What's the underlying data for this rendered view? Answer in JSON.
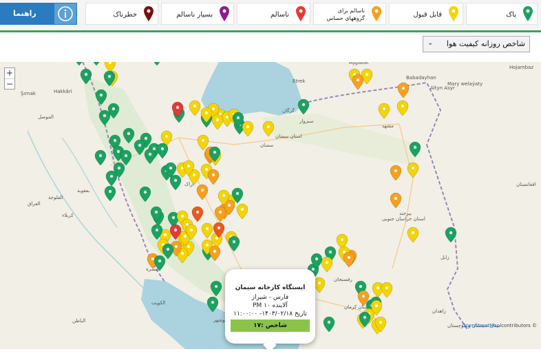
{
  "legend": {
    "items": [
      {
        "label": "پاک",
        "color": "#1aa260"
      },
      {
        "label": "قابل قبول",
        "color": "#f5d400"
      },
      {
        "label": "ناسالم برای گروههای حساس",
        "color": "#f7a01b"
      },
      {
        "label": "ناسالم",
        "color": "#e53935"
      },
      {
        "label": "بسیار ناسالم",
        "color": "#8e1a8e"
      },
      {
        "label": "خطرناک",
        "color": "#7b0f0f"
      }
    ],
    "help_label": "راهنما",
    "help_icon": "info-icon"
  },
  "toolbar": {
    "select_value": "شاخص روزانه کیفیت هوا"
  },
  "map": {
    "zoom_in": "+",
    "zoom_out": "−",
    "attribution_link": "OpenStreetMap",
    "attribution_text": " contributors ©",
    "labels": [
      {
        "text": "Aşgabat"
      },
      {
        "text": "Etrek"
      },
      {
        "text": "Babadayhan"
      },
      {
        "text": "Altyn Asyr"
      },
      {
        "text": "Hojambaz"
      },
      {
        "text": "Mary welaýaty"
      },
      {
        "text": "Şırnak"
      },
      {
        "text": "Hakkâri"
      },
      {
        "text": "الموصل"
      },
      {
        "text": "العراق"
      },
      {
        "text": "بعقوبة"
      },
      {
        "text": "الفلوجة"
      },
      {
        "text": "کربلاء"
      },
      {
        "text": "البصرة"
      },
      {
        "text": "الكويت"
      },
      {
        "text": "الباطن"
      },
      {
        "text": "گرگان"
      },
      {
        "text": "سمنان"
      },
      {
        "text": "سبزوار"
      },
      {
        "text": "مشهد"
      },
      {
        "text": "بیرجند"
      },
      {
        "text": "اراک"
      },
      {
        "text": "زابل"
      },
      {
        "text": "زاهدان"
      },
      {
        "text": "رفسنجان"
      },
      {
        "text": "استان کرمان"
      },
      {
        "text": "بم"
      },
      {
        "text": "استان بوشهر"
      },
      {
        "text": "افغانستان"
      },
      {
        "text": "استان خراسان جنوبی"
      },
      {
        "text": "استان سمنان"
      },
      {
        "text": "استان سیستان و بلوچستان"
      }
    ],
    "pins": [
      {
        "c": "#1aa260"
      },
      {
        "c": "#1aa260"
      },
      {
        "c": "#1aa260"
      },
      {
        "c": "#1aa260"
      },
      {
        "c": "#1aa260"
      },
      {
        "c": "#f5d400"
      },
      {
        "c": "#f5d400"
      },
      {
        "c": "#1aa260"
      },
      {
        "c": "#1aa260"
      },
      {
        "c": "#1aa260"
      },
      {
        "c": "#1aa260"
      },
      {
        "c": "#1aa260"
      },
      {
        "c": "#1aa260"
      },
      {
        "c": "#1aa260"
      },
      {
        "c": "#f5d400"
      },
      {
        "c": "#1aa260"
      },
      {
        "c": "#1aa260"
      },
      {
        "c": "#1aa260"
      },
      {
        "c": "#1aa260"
      },
      {
        "c": "#1aa260"
      },
      {
        "c": "#1aa260"
      },
      {
        "c": "#1aa260"
      },
      {
        "c": "#1aa260"
      },
      {
        "c": "#1aa260"
      },
      {
        "c": "#1aa260"
      },
      {
        "c": "#1aa260"
      },
      {
        "c": "#1aa260"
      },
      {
        "c": "#f5d400"
      },
      {
        "c": "#1aa260"
      },
      {
        "c": "#1aa260"
      },
      {
        "c": "#1aa260"
      },
      {
        "c": "#f5d400"
      },
      {
        "c": "#f5d400"
      },
      {
        "c": "#f5d400"
      },
      {
        "c": "#f7a01b"
      },
      {
        "c": "#f7a01b"
      },
      {
        "c": "#f5d400"
      },
      {
        "c": "#1aa260"
      },
      {
        "c": "#1aa260"
      },
      {
        "c": "#1aa260"
      },
      {
        "c": "#1aa260"
      },
      {
        "c": "#f5d400"
      },
      {
        "c": "#f5d400"
      },
      {
        "c": "#f5d400"
      },
      {
        "c": "#f7a01b"
      },
      {
        "c": "#f5d400"
      },
      {
        "c": "#f7a01b"
      },
      {
        "c": "#f7a01b"
      },
      {
        "c": "#1aa260"
      },
      {
        "c": "#f7a01b"
      },
      {
        "c": "#f5d400"
      },
      {
        "c": "#1aa260"
      },
      {
        "c": "#f5d400"
      },
      {
        "c": "#1aa260"
      },
      {
        "c": "#1aa260"
      },
      {
        "c": "#f5d400"
      },
      {
        "c": "#f5d400"
      },
      {
        "c": "#e53935"
      },
      {
        "c": "#f5d400"
      },
      {
        "c": "#f5d400"
      },
      {
        "c": "#f5d400"
      },
      {
        "c": "#f5d400"
      },
      {
        "c": "#f5d400"
      },
      {
        "c": "#f5d400"
      },
      {
        "c": "#f5d400"
      },
      {
        "c": "#1aa260"
      },
      {
        "c": "#f5d400"
      },
      {
        "c": "#f5d400"
      },
      {
        "c": "#f7a01b"
      },
      {
        "c": "#f7a01b"
      },
      {
        "c": "#f5d400"
      },
      {
        "c": "#1aa260"
      },
      {
        "c": "#f5d400"
      },
      {
        "c": "#f5d400"
      },
      {
        "c": "#f7a01b"
      },
      {
        "c": "#f7a01b"
      },
      {
        "c": "#1aa260"
      },
      {
        "c": "#1aa260"
      },
      {
        "c": "#f5d400"
      },
      {
        "c": "#f7a01b"
      },
      {
        "c": "#f5d400"
      },
      {
        "c": "#f7a01b"
      },
      {
        "c": "#1aa260"
      },
      {
        "c": "#f7a01b"
      },
      {
        "c": "#f5d400"
      },
      {
        "c": "#f5d400"
      },
      {
        "c": "#f5d400"
      },
      {
        "c": "#1aa260"
      },
      {
        "c": "#1aa260"
      },
      {
        "c": "#e53935"
      },
      {
        "c": "#f7a01b"
      },
      {
        "c": "#1aa260"
      },
      {
        "c": "#f5d400"
      },
      {
        "c": "#e53935"
      },
      {
        "c": "#f7a01b"
      },
      {
        "c": "#f5d400"
      },
      {
        "c": "#f5d400"
      },
      {
        "c": "#f5d400"
      },
      {
        "c": "#f5d400"
      },
      {
        "c": "#e85a1a"
      },
      {
        "c": "#f7a01b"
      },
      {
        "c": "#f5d400"
      },
      {
        "c": "#1aa260"
      },
      {
        "c": "#f5d400"
      },
      {
        "c": "#1aa260"
      },
      {
        "c": "#f5d400"
      },
      {
        "c": "#f5d400"
      },
      {
        "c": "#f5d400"
      },
      {
        "c": "#1aa260"
      },
      {
        "c": "#f7a01b"
      },
      {
        "c": "#e85a1a"
      },
      {
        "c": "#f7a01b"
      },
      {
        "c": "#1aa260"
      },
      {
        "c": "#f5d400"
      },
      {
        "c": "#f5d400"
      },
      {
        "c": "#1aa260"
      },
      {
        "c": "#1aa260"
      },
      {
        "c": "#1aa260"
      },
      {
        "c": "#1aa260"
      },
      {
        "c": "#1aa260"
      },
      {
        "c": "#f5d400"
      },
      {
        "c": "#f5d400"
      },
      {
        "c": "#f5d400"
      },
      {
        "c": "#f5d400"
      },
      {
        "c": "#f5d400"
      },
      {
        "c": "#f5d400"
      },
      {
        "c": "#1aa260"
      }
    ]
  },
  "popup": {
    "station": "ایستگاه کارخانه سیمان",
    "city": "فارس - شیراز",
    "pollutant": "آلاینده PM ۱۰",
    "date": "تاریخ ۱۴۰۳/۰۲/۱۸- ۱۱:۰۰:۰۰",
    "index": "شاخص :۱۷"
  }
}
